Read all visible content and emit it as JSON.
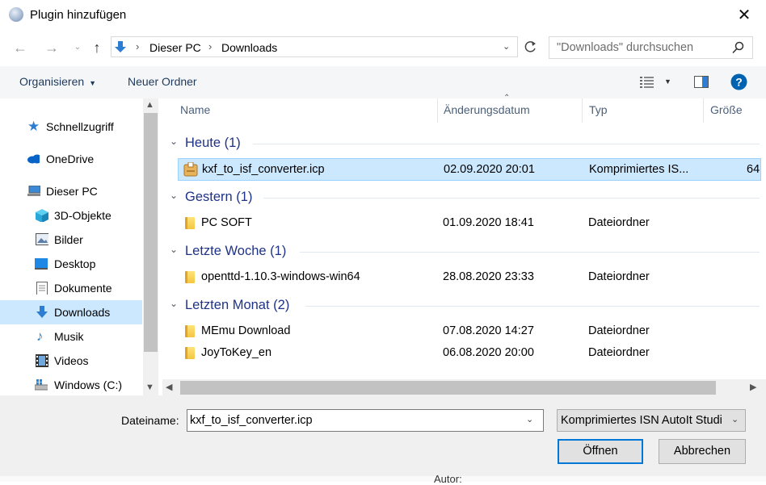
{
  "window": {
    "title": "Plugin hinzufügen"
  },
  "nav": {
    "breadcrumb": [
      "Dieser PC",
      "Downloads"
    ],
    "search_placeholder": "\"Downloads\" durchsuchen"
  },
  "toolbar": {
    "organise": "Organisieren",
    "new_folder": "Neuer Ordner"
  },
  "sidebar": {
    "items": [
      {
        "label": "Schnellzugriff",
        "icon": "star-icon"
      },
      {
        "label": "OneDrive",
        "icon": "cloud-icon"
      },
      {
        "label": "Dieser PC",
        "icon": "computer-icon"
      },
      {
        "label": "3D-Objekte",
        "icon": "cube-icon"
      },
      {
        "label": "Bilder",
        "icon": "pictures-icon"
      },
      {
        "label": "Desktop",
        "icon": "desktop-icon"
      },
      {
        "label": "Dokumente",
        "icon": "document-icon"
      },
      {
        "label": "Downloads",
        "icon": "download-arrow-icon"
      },
      {
        "label": "Musik",
        "icon": "music-note-icon"
      },
      {
        "label": "Videos",
        "icon": "film-icon"
      },
      {
        "label": "Windows (C:)",
        "icon": "drive-icon"
      }
    ]
  },
  "columns": {
    "name": "Name",
    "date": "Änderungsdatum",
    "type": "Typ",
    "size": "Größe"
  },
  "groups": [
    {
      "title": "Heute (1)",
      "files": [
        {
          "name": "kxf_to_isf_converter.icp",
          "date": "02.09.2020 20:01",
          "type": "Komprimiertes IS...",
          "size": "64"
        }
      ]
    },
    {
      "title": "Gestern (1)",
      "files": [
        {
          "name": "PC SOFT",
          "date": "01.09.2020 18:41",
          "type": "Dateiordner",
          "size": ""
        }
      ]
    },
    {
      "title": "Letzte Woche (1)",
      "files": [
        {
          "name": "openttd-1.10.3-windows-win64",
          "date": "28.08.2020 23:33",
          "type": "Dateiordner",
          "size": ""
        }
      ]
    },
    {
      "title": "Letzten Monat (2)",
      "files": [
        {
          "name": "MEmu Download",
          "date": "07.08.2020 14:27",
          "type": "Dateiordner",
          "size": ""
        },
        {
          "name": "JoyToKey_en",
          "date": "06.08.2020 20:00",
          "type": "Dateiordner",
          "size": ""
        }
      ]
    }
  ],
  "footer": {
    "filename_label": "Dateiname:",
    "filename_value": "kxf_to_isf_converter.icp",
    "filetype_value": "Komprimiertes ISN AutoIt Studi",
    "open_label": "Öffnen",
    "cancel_label": "Abbrechen"
  },
  "background": {
    "autor": "Autor:"
  },
  "colors": {
    "accent": "#0078d7",
    "selection": "#cce8ff",
    "group_title": "#1e3287",
    "help": "#0063b1"
  }
}
